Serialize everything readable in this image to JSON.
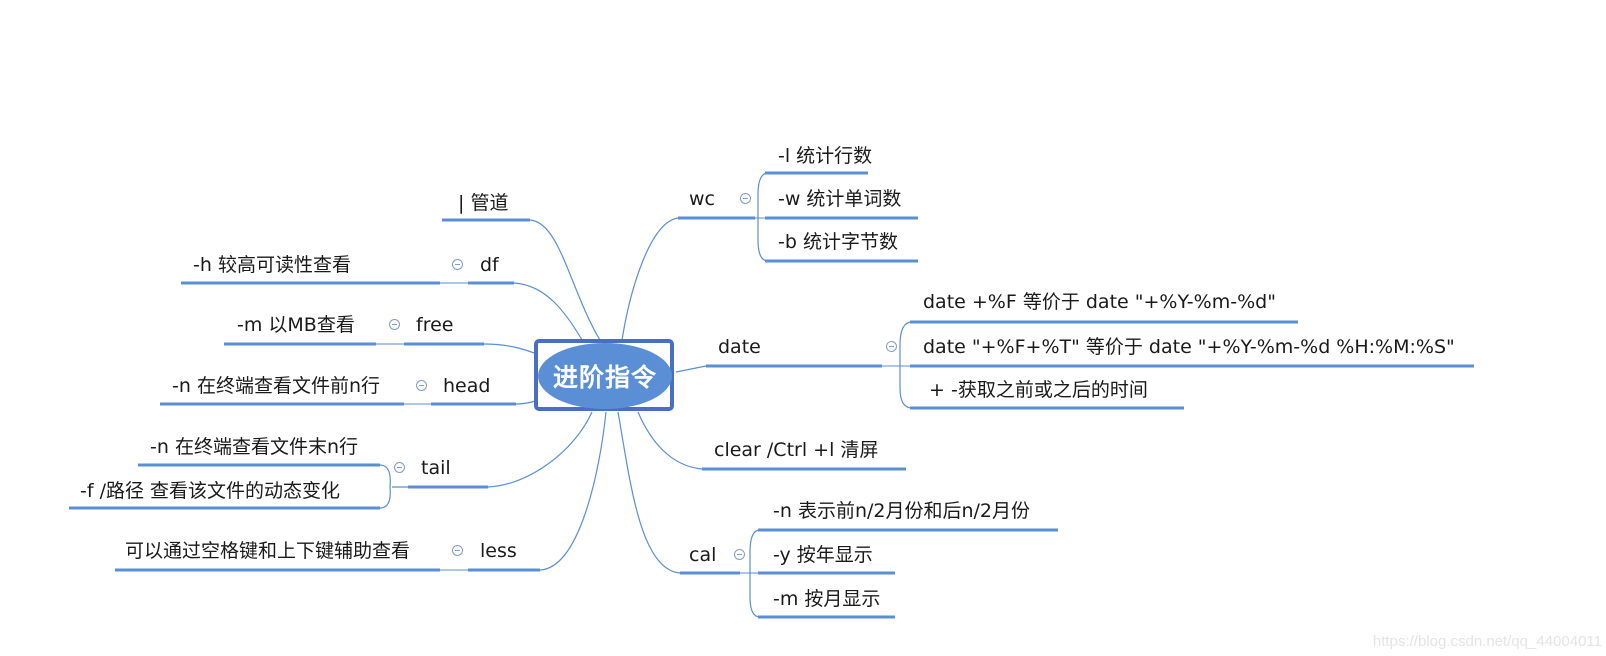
{
  "root": {
    "label": "进阶指令"
  },
  "colors": {
    "branch_line": "#5a8fd6",
    "connector": "#5a8fd6",
    "root_fill": "#5a8fd6",
    "root_border": "#4a6fc2"
  },
  "left_branches": [
    {
      "id": "pipe",
      "label": "|  管道",
      "children": []
    },
    {
      "id": "df",
      "label": "df",
      "children": [
        {
          "label": "-h 较高可读性查看"
        }
      ]
    },
    {
      "id": "free",
      "label": "free",
      "children": [
        {
          "label": "-m 以MB查看"
        }
      ]
    },
    {
      "id": "head",
      "label": "head",
      "children": [
        {
          "label": "-n 在终端查看文件前n行"
        }
      ]
    },
    {
      "id": "tail",
      "label": "tail",
      "children": [
        {
          "label": "-n 在终端查看文件末n行"
        },
        {
          "label": "-f /路径    查看该文件的动态变化"
        }
      ]
    },
    {
      "id": "less",
      "label": "less",
      "children": [
        {
          "label": "可以通过空格键和上下键辅助查看"
        }
      ]
    }
  ],
  "right_branches": [
    {
      "id": "wc",
      "label": "wc",
      "children": [
        {
          "label": "-l  统计行数"
        },
        {
          "label": "-w 统计单词数"
        },
        {
          "label": "-b 统计字节数"
        }
      ]
    },
    {
      "id": "date",
      "label": "date",
      "children": [
        {
          "label": "date +%F  等价于 date \"+%Y-%m-%d\""
        },
        {
          "label": "date \"+%F+%T\"  等价于 date \"+%Y-%m-%d %H:%M:%S\""
        },
        {
          "label": "+ -获取之前或之后的时间"
        }
      ]
    },
    {
      "id": "clear",
      "label": "clear /Ctrl  +l 清屏",
      "children": []
    },
    {
      "id": "cal",
      "label": "cal",
      "children": [
        {
          "label": "-n  表示前n/2月份和后n/2月份"
        },
        {
          "label": "-y  按年显示"
        },
        {
          "label": "-m  按月显示"
        }
      ]
    }
  ],
  "watermark": "https://blog.csdn.net/qq_44004011"
}
